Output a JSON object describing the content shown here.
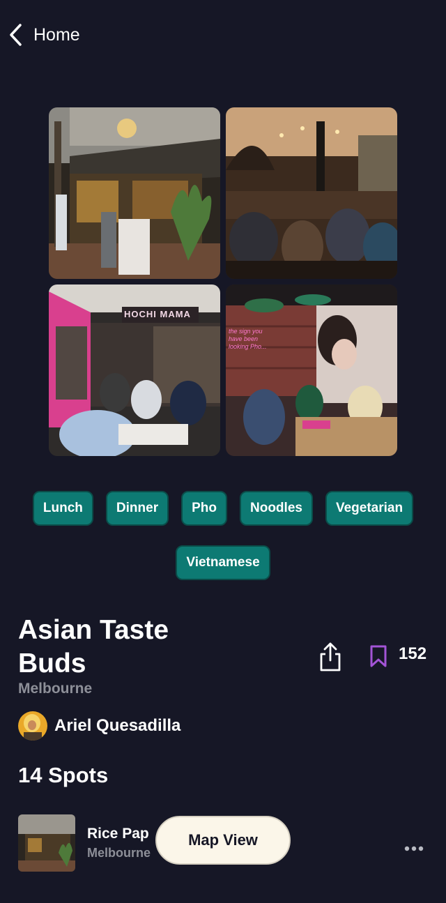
{
  "nav": {
    "back_label": "Home"
  },
  "gallery": {
    "photos": [
      "restaurant-exterior-photo",
      "restaurant-interior-photo",
      "hochi-mama-storefront-photo",
      "neon-interior-photo"
    ]
  },
  "storefront_sign": "HOCHI MAMA",
  "neon_sign": "the sign you have been looking Pho...",
  "tags": [
    "Lunch",
    "Dinner",
    "Pho",
    "Noodles",
    "Vegetarian",
    "Vietnamese"
  ],
  "list": {
    "title": "Asian Taste Buds",
    "city": "Melbourne",
    "bookmark_count": "152",
    "author": "Ariel Quesadilla",
    "spots_label": "14 Spots"
  },
  "spots": [
    {
      "name": "Rice Pap",
      "city": "Melbourne"
    }
  ],
  "map_button": "Map View",
  "colors": {
    "background": "#161726",
    "tag": "#0d7a73",
    "bookmark": "#a354d6",
    "map_button": "#fbf6e9"
  }
}
